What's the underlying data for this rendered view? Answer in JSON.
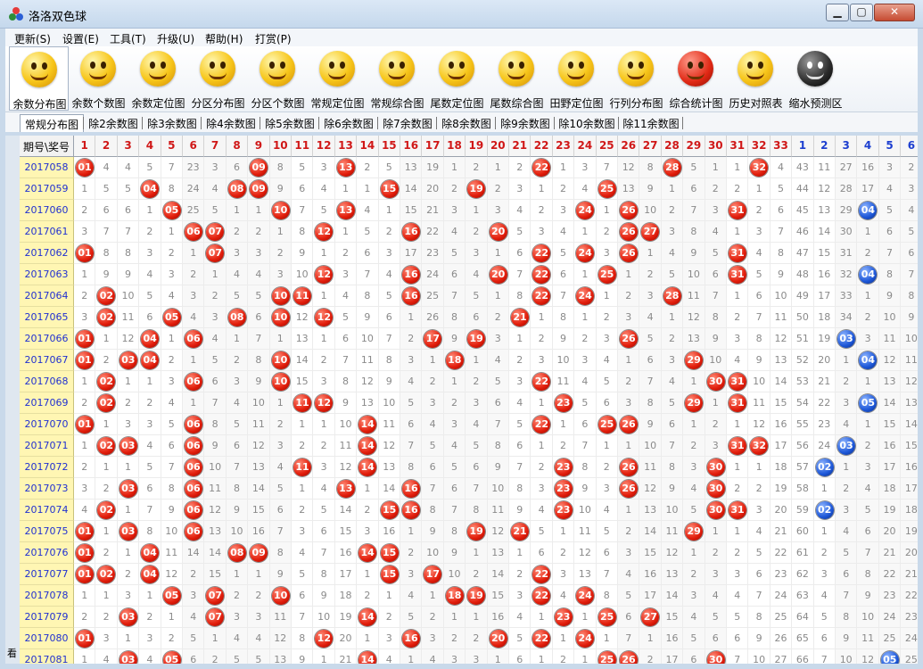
{
  "window": {
    "title": "洛洛双色球",
    "minimize": "▁",
    "maximize": "▢",
    "close": "✕"
  },
  "menu": [
    "更新(S)",
    "设置(E)",
    "工具(T)",
    "升级(U)",
    "帮助(H)",
    "打赏(P)"
  ],
  "toolbar": [
    {
      "label": "余数分布图",
      "icon": "grin-smiley-icon",
      "style": "yellow"
    },
    {
      "label": "余数个数图",
      "icon": "heart-eyes-smiley-icon",
      "style": "yellow"
    },
    {
      "label": "余数定位图",
      "icon": "tongue-smiley-icon",
      "style": "yellow"
    },
    {
      "label": "分区分布图",
      "icon": "sleepy-smiley-icon",
      "style": "yellow"
    },
    {
      "label": "分区个数图",
      "icon": "sunglasses-smiley-icon",
      "style": "yellow"
    },
    {
      "label": "常规定位图",
      "icon": "headset-smiley-icon",
      "style": "yellow"
    },
    {
      "label": "常规综合图",
      "icon": "dizzy-smiley-icon",
      "style": "yellow"
    },
    {
      "label": "尾数定位图",
      "icon": "sleeping-smiley-icon",
      "style": "yellow"
    },
    {
      "label": "尾数综合图",
      "icon": "sweat-smiley-icon",
      "style": "yellow"
    },
    {
      "label": "田野定位图",
      "icon": "crying-smiley-icon",
      "style": "yellow"
    },
    {
      "label": "行列分布图",
      "icon": "quiet-smiley-icon",
      "style": "yellow"
    },
    {
      "label": "综合统计图",
      "icon": "angry-devil-icon",
      "style": "red"
    },
    {
      "label": "历史对照表",
      "icon": "surprised-smiley-icon",
      "style": "yellow"
    },
    {
      "label": "缩水预测区",
      "icon": "dark-smiley-icon",
      "style": "dark"
    }
  ],
  "tabs": [
    "常规分布图",
    "除2余数图",
    "除3余数图",
    "除4余数图",
    "除5余数图",
    "除6余数图",
    "除7余数图",
    "除8余数图",
    "除9余数图",
    "除10余数图",
    "除11余数图"
  ],
  "active_tab": 0,
  "grid": {
    "corner": "期号\\奖号",
    "red_headers": [
      "1",
      "2",
      "3",
      "4",
      "5",
      "6",
      "7",
      "8",
      "9",
      "10",
      "11",
      "12",
      "13",
      "14",
      "15",
      "16",
      "17",
      "18",
      "19",
      "20",
      "21",
      "22",
      "23",
      "24",
      "25",
      "26",
      "27",
      "28",
      "29",
      "30",
      "31",
      "32",
      "33"
    ],
    "blue_headers": [
      "1",
      "2",
      "3",
      "4",
      "5",
      "6"
    ],
    "rows": [
      {
        "period": "2017058",
        "cells": [
          "01",
          "4",
          "4",
          "5",
          "7",
          "23",
          "3",
          "6",
          "09",
          "8",
          "5",
          "3",
          "13",
          "2",
          "5",
          "13",
          "19",
          "1",
          "2",
          "1",
          "2",
          "22",
          "1",
          "3",
          "7",
          "12",
          "8",
          "28",
          "5",
          "1",
          "1",
          "32",
          "4",
          "43",
          "11",
          "27",
          "16",
          "3",
          "2"
        ]
      },
      {
        "period": "2017059",
        "cells": [
          "1",
          "5",
          "5",
          "04",
          "8",
          "24",
          "4",
          "08",
          "09",
          "9",
          "6",
          "4",
          "1",
          "1",
          "15",
          "14",
          "20",
          "2",
          "19",
          "2",
          "3",
          "1",
          "2",
          "4",
          "25",
          "13",
          "9",
          "1",
          "6",
          "2",
          "2",
          "1",
          "5",
          "44",
          "12",
          "28",
          "17",
          "4",
          "3"
        ]
      },
      {
        "period": "2017060",
        "cells": [
          "2",
          "6",
          "6",
          "1",
          "05",
          "25",
          "5",
          "1",
          "1",
          "10",
          "7",
          "5",
          "13",
          "4",
          "1",
          "15",
          "21",
          "3",
          "1",
          "3",
          "4",
          "2",
          "3",
          "24",
          "1",
          "26",
          "10",
          "2",
          "7",
          "3",
          "31",
          "2",
          "6",
          "45",
          "13",
          "29",
          "04",
          "5",
          "4"
        ]
      },
      {
        "period": "2017061",
        "cells": [
          "3",
          "7",
          "7",
          "2",
          "1",
          "06",
          "07",
          "2",
          "2",
          "1",
          "8",
          "12",
          "1",
          "5",
          "2",
          "16",
          "22",
          "4",
          "2",
          "20",
          "5",
          "3",
          "4",
          "1",
          "2",
          "26",
          "27",
          "3",
          "8",
          "4",
          "1",
          "3",
          "7",
          "46",
          "14",
          "30",
          "1",
          "6",
          "5"
        ]
      },
      {
        "period": "2017062",
        "cells": [
          "01",
          "8",
          "8",
          "3",
          "2",
          "1",
          "07",
          "3",
          "3",
          "2",
          "9",
          "1",
          "2",
          "6",
          "3",
          "17",
          "23",
          "5",
          "3",
          "1",
          "6",
          "22",
          "5",
          "24",
          "3",
          "26",
          "1",
          "4",
          "9",
          "5",
          "31",
          "4",
          "8",
          "47",
          "15",
          "31",
          "2",
          "7",
          "6"
        ]
      },
      {
        "period": "2017063",
        "cells": [
          "1",
          "9",
          "9",
          "4",
          "3",
          "2",
          "1",
          "4",
          "4",
          "3",
          "10",
          "12",
          "3",
          "7",
          "4",
          "16",
          "24",
          "6",
          "4",
          "20",
          "7",
          "22",
          "6",
          "1",
          "25",
          "1",
          "2",
          "5",
          "10",
          "6",
          "31",
          "5",
          "9",
          "48",
          "16",
          "32",
          "04",
          "8",
          "7"
        ]
      },
      {
        "period": "2017064",
        "cells": [
          "2",
          "02",
          "10",
          "5",
          "4",
          "3",
          "2",
          "5",
          "5",
          "10",
          "11",
          "1",
          "4",
          "8",
          "5",
          "16",
          "25",
          "7",
          "5",
          "1",
          "8",
          "22",
          "7",
          "24",
          "1",
          "2",
          "3",
          "28",
          "11",
          "7",
          "1",
          "6",
          "10",
          "49",
          "17",
          "33",
          "1",
          "9",
          "8"
        ]
      },
      {
        "period": "2017065",
        "cells": [
          "3",
          "02",
          "11",
          "6",
          "05",
          "4",
          "3",
          "08",
          "6",
          "10",
          "12",
          "12",
          "5",
          "9",
          "6",
          "1",
          "26",
          "8",
          "6",
          "2",
          "21",
          "1",
          "8",
          "1",
          "2",
          "3",
          "4",
          "1",
          "12",
          "8",
          "2",
          "7",
          "11",
          "50",
          "18",
          "34",
          "2",
          "10",
          "9"
        ]
      },
      {
        "period": "2017066",
        "cells": [
          "01",
          "1",
          "12",
          "04",
          "1",
          "06",
          "4",
          "1",
          "7",
          "1",
          "13",
          "1",
          "6",
          "10",
          "7",
          "2",
          "17",
          "9",
          "19",
          "3",
          "1",
          "2",
          "9",
          "2",
          "3",
          "26",
          "5",
          "2",
          "13",
          "9",
          "3",
          "8",
          "12",
          "51",
          "19",
          "03",
          "3",
          "11",
          "10"
        ]
      },
      {
        "period": "2017067",
        "cells": [
          "01",
          "2",
          "03",
          "04",
          "2",
          "1",
          "5",
          "2",
          "8",
          "10",
          "14",
          "2",
          "7",
          "11",
          "8",
          "3",
          "1",
          "18",
          "1",
          "4",
          "2",
          "3",
          "10",
          "3",
          "4",
          "1",
          "6",
          "3",
          "29",
          "10",
          "4",
          "9",
          "13",
          "52",
          "20",
          "1",
          "04",
          "12",
          "11"
        ]
      },
      {
        "period": "2017068",
        "cells": [
          "1",
          "02",
          "1",
          "1",
          "3",
          "06",
          "6",
          "3",
          "9",
          "10",
          "15",
          "3",
          "8",
          "12",
          "9",
          "4",
          "2",
          "1",
          "2",
          "5",
          "3",
          "22",
          "11",
          "4",
          "5",
          "2",
          "7",
          "4",
          "1",
          "30",
          "31",
          "10",
          "14",
          "53",
          "21",
          "2",
          "1",
          "13",
          "12"
        ]
      },
      {
        "period": "2017069",
        "cells": [
          "2",
          "02",
          "2",
          "2",
          "4",
          "1",
          "7",
          "4",
          "10",
          "1",
          "11",
          "12",
          "9",
          "13",
          "10",
          "5",
          "3",
          "2",
          "3",
          "6",
          "4",
          "1",
          "23",
          "5",
          "6",
          "3",
          "8",
          "5",
          "29",
          "1",
          "31",
          "11",
          "15",
          "54",
          "22",
          "3",
          "05",
          "14",
          "13"
        ]
      },
      {
        "period": "2017070",
        "cells": [
          "01",
          "1",
          "3",
          "3",
          "5",
          "06",
          "8",
          "5",
          "11",
          "2",
          "1",
          "1",
          "10",
          "14",
          "11",
          "6",
          "4",
          "3",
          "4",
          "7",
          "5",
          "22",
          "1",
          "6",
          "25",
          "26",
          "9",
          "6",
          "1",
          "2",
          "1",
          "12",
          "16",
          "55",
          "23",
          "4",
          "1",
          "15",
          "14"
        ]
      },
      {
        "period": "2017071",
        "cells": [
          "1",
          "02",
          "03",
          "4",
          "6",
          "06",
          "9",
          "6",
          "12",
          "3",
          "2",
          "2",
          "11",
          "14",
          "12",
          "7",
          "5",
          "4",
          "5",
          "8",
          "6",
          "1",
          "2",
          "7",
          "1",
          "1",
          "10",
          "7",
          "2",
          "3",
          "31",
          "32",
          "17",
          "56",
          "24",
          "03",
          "2",
          "16",
          "15"
        ]
      },
      {
        "period": "2017072",
        "cells": [
          "2",
          "1",
          "1",
          "5",
          "7",
          "06",
          "10",
          "7",
          "13",
          "4",
          "11",
          "3",
          "12",
          "14",
          "13",
          "8",
          "6",
          "5",
          "6",
          "9",
          "7",
          "2",
          "23",
          "8",
          "2",
          "26",
          "11",
          "8",
          "3",
          "30",
          "1",
          "1",
          "18",
          "57",
          "02",
          "1",
          "3",
          "17",
          "16"
        ]
      },
      {
        "period": "2017073",
        "cells": [
          "3",
          "2",
          "03",
          "6",
          "8",
          "06",
          "11",
          "8",
          "14",
          "5",
          "1",
          "4",
          "13",
          "1",
          "14",
          "16",
          "7",
          "6",
          "7",
          "10",
          "8",
          "3",
          "23",
          "9",
          "3",
          "26",
          "12",
          "9",
          "4",
          "30",
          "2",
          "2",
          "19",
          "58",
          "1",
          "2",
          "4",
          "18",
          "17"
        ]
      },
      {
        "period": "2017074",
        "cells": [
          "4",
          "02",
          "1",
          "7",
          "9",
          "06",
          "12",
          "9",
          "15",
          "6",
          "2",
          "5",
          "14",
          "2",
          "15",
          "16",
          "8",
          "7",
          "8",
          "11",
          "9",
          "4",
          "23",
          "10",
          "4",
          "1",
          "13",
          "10",
          "5",
          "30",
          "31",
          "3",
          "20",
          "59",
          "02",
          "3",
          "5",
          "19",
          "18"
        ]
      },
      {
        "period": "2017075",
        "cells": [
          "01",
          "1",
          "03",
          "8",
          "10",
          "06",
          "13",
          "10",
          "16",
          "7",
          "3",
          "6",
          "15",
          "3",
          "16",
          "1",
          "9",
          "8",
          "19",
          "12",
          "21",
          "5",
          "1",
          "11",
          "5",
          "2",
          "14",
          "11",
          "29",
          "1",
          "1",
          "4",
          "21",
          "60",
          "1",
          "4",
          "6",
          "20",
          "19"
        ]
      },
      {
        "period": "2017076",
        "cells": [
          "01",
          "2",
          "1",
          "04",
          "11",
          "14",
          "14",
          "08",
          "09",
          "8",
          "4",
          "7",
          "16",
          "14",
          "15",
          "2",
          "10",
          "9",
          "1",
          "13",
          "1",
          "6",
          "2",
          "12",
          "6",
          "3",
          "15",
          "12",
          "1",
          "2",
          "2",
          "5",
          "22",
          "61",
          "2",
          "5",
          "7",
          "21",
          "20"
        ]
      },
      {
        "period": "2017077",
        "cells": [
          "01",
          "02",
          "2",
          "04",
          "12",
          "2",
          "15",
          "1",
          "1",
          "9",
          "5",
          "8",
          "17",
          "1",
          "15",
          "3",
          "17",
          "10",
          "2",
          "14",
          "2",
          "22",
          "3",
          "13",
          "7",
          "4",
          "16",
          "13",
          "2",
          "3",
          "3",
          "6",
          "23",
          "62",
          "3",
          "6",
          "8",
          "22",
          "21"
        ]
      },
      {
        "period": "2017078",
        "cells": [
          "1",
          "1",
          "3",
          "1",
          "05",
          "3",
          "07",
          "2",
          "2",
          "10",
          "6",
          "9",
          "18",
          "2",
          "1",
          "4",
          "1",
          "18",
          "19",
          "15",
          "3",
          "22",
          "4",
          "24",
          "8",
          "5",
          "17",
          "14",
          "3",
          "4",
          "4",
          "7",
          "24",
          "63",
          "4",
          "7",
          "9",
          "23",
          "22"
        ]
      },
      {
        "period": "2017079",
        "cells": [
          "2",
          "2",
          "03",
          "2",
          "1",
          "4",
          "07",
          "3",
          "3",
          "11",
          "7",
          "10",
          "19",
          "14",
          "2",
          "5",
          "2",
          "1",
          "1",
          "16",
          "4",
          "1",
          "23",
          "1",
          "25",
          "6",
          "27",
          "15",
          "4",
          "5",
          "5",
          "8",
          "25",
          "64",
          "5",
          "8",
          "10",
          "24",
          "23"
        ]
      },
      {
        "period": "2017080",
        "cells": [
          "01",
          "3",
          "1",
          "3",
          "2",
          "5",
          "1",
          "4",
          "4",
          "12",
          "8",
          "12",
          "20",
          "1",
          "3",
          "16",
          "3",
          "2",
          "2",
          "20",
          "5",
          "22",
          "1",
          "24",
          "1",
          "7",
          "1",
          "16",
          "5",
          "6",
          "6",
          "9",
          "26",
          "65",
          "6",
          "9",
          "11",
          "25",
          "24"
        ]
      },
      {
        "period": "2017081",
        "cells": [
          "1",
          "4",
          "03",
          "4",
          "05",
          "6",
          "2",
          "5",
          "5",
          "13",
          "9",
          "1",
          "21",
          "14",
          "4",
          "1",
          "4",
          "3",
          "3",
          "1",
          "6",
          "1",
          "2",
          "1",
          "25",
          "26",
          "2",
          "17",
          "6",
          "30",
          "7",
          "10",
          "27",
          "66",
          "7",
          "10",
          "12",
          "05",
          "25"
        ]
      }
    ]
  },
  "side_strip_text": "看"
}
